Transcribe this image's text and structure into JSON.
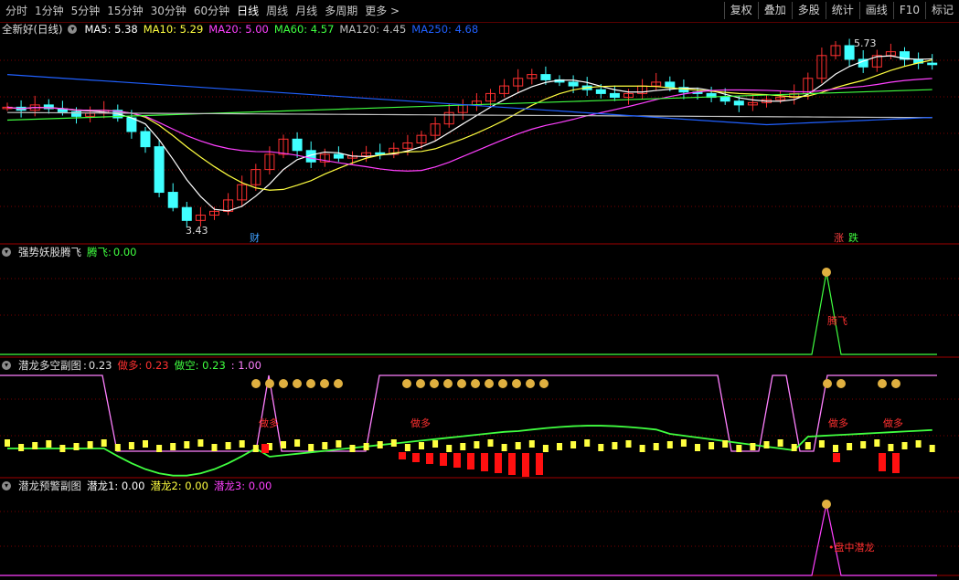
{
  "toolbar": {
    "tabs": [
      "分时",
      "1分钟",
      "5分钟",
      "15分钟",
      "30分钟",
      "60分钟",
      "日线",
      "周线",
      "月线",
      "多周期",
      "更多 >"
    ],
    "active_tab": "日线",
    "right_buttons": [
      "复权",
      "叠加",
      "多股",
      "统计",
      "画线",
      "F10",
      "标记"
    ]
  },
  "main": {
    "stock_name": "全新好",
    "period": "(日线)",
    "ma_labels": [
      {
        "name": "MA5",
        "value": "5.38",
        "color": "#ffffff"
      },
      {
        "name": "MA10",
        "value": "5.29",
        "color": "#ffff40"
      },
      {
        "name": "MA20",
        "value": "5.00",
        "color": "#ff40ff"
      },
      {
        "name": "MA60",
        "value": "4.57",
        "color": "#40ff40"
      },
      {
        "name": "MA120",
        "value": "4.45",
        "color": "#c0c0c0"
      },
      {
        "name": "MA250",
        "value": "4.68",
        "color": "#2060ff"
      }
    ],
    "high_label": "5.73",
    "low_label": "3.43",
    "cai_label": "财",
    "zhang_label": "涨",
    "die_label": "跌"
  },
  "pane1": {
    "title": "强势妖股腾飞",
    "field": "腾飞",
    "value": "0.00",
    "signal_text": "腾飞"
  },
  "pane2": {
    "title": "潜龙多空副图",
    "value": "0.23",
    "fields": [
      {
        "name": "做多",
        "value": "0.23",
        "color": "#ff3030"
      },
      {
        "name": "做空",
        "value": "0.23",
        "color": "#40ff40"
      },
      {
        "name": "",
        "value": "1.00",
        "color": "#ff80ff"
      }
    ],
    "signal_text": "做多"
  },
  "pane3": {
    "title": "潜龙预警副图",
    "fields": [
      {
        "name": "潜龙1",
        "value": "0.00",
        "color": "#ffffff"
      },
      {
        "name": "潜龙2",
        "value": "0.00",
        "color": "#ffff40"
      },
      {
        "name": "潜龙3",
        "value": "0.00",
        "color": "#ff40ff"
      }
    ],
    "signal_text": "盘中潜龙"
  },
  "colors": {
    "up": "#ff3030",
    "down": "#40ffff",
    "grid": "#7a0000",
    "divider": "#a00000"
  }
}
